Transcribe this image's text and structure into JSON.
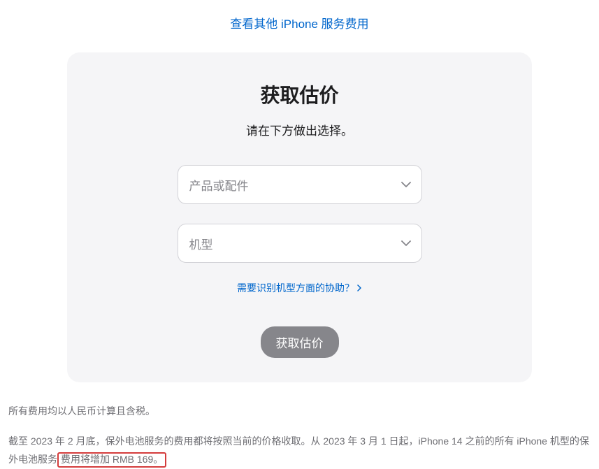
{
  "topLink": "查看其他 iPhone 服务费用",
  "card": {
    "title": "获取估价",
    "subtitle": "请在下方做出选择。",
    "productSelect": "产品或配件",
    "modelSelect": "机型",
    "helpLink": "需要识别机型方面的协助？",
    "submitButton": "获取估价"
  },
  "footer": {
    "line1": "所有费用均以人民币计算且含税。",
    "line2Part1": "截至 2023 年 2 月底，保外电池服务的费用都将按照当前的价格收取。从 2023 年 3 月 1 日起，iPhone 14 之前的所有 iPhone 机型的保外电池服务",
    "line2Highlight": "费用将增加 RMB 169。"
  }
}
